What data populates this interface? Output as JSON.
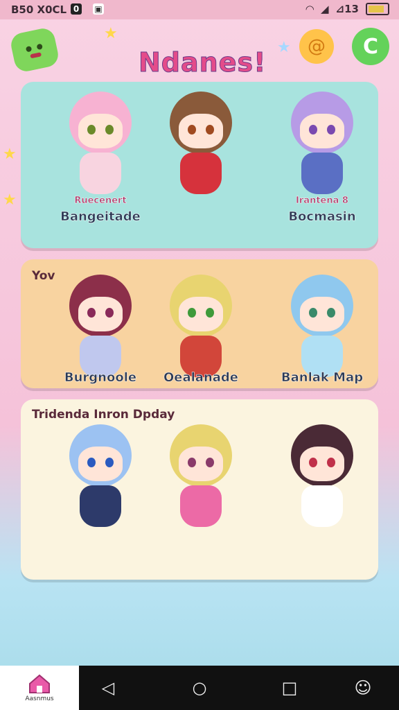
{
  "status_bar": {
    "left_text": "B50 X0CL",
    "badge": "0",
    "right_text": "⊿13"
  },
  "header": {
    "title": "Ndanes!"
  },
  "sections": [
    {
      "label": "",
      "characters": [
        {
          "name": "Bangeitade",
          "caption": "Ruecenert",
          "hair": "#f7b2d2",
          "outfit": "#f8d4e0",
          "eye": "#6a8a2a"
        },
        {
          "name": "",
          "caption": "",
          "hair": "#8a5a3a",
          "outfit": "#d6323c",
          "eye": "#a04a20"
        },
        {
          "name": "Bocmasin",
          "caption": "Irantena 8",
          "hair": "#b79be6",
          "outfit": "#5a6fc4",
          "eye": "#7a4ab0"
        }
      ]
    },
    {
      "label": "Yov",
      "characters": [
        {
          "name": "Burgnoole",
          "caption": "",
          "hair": "#8c2f4a",
          "outfit": "#c0c8ee",
          "eye": "#8a2a5a"
        },
        {
          "name": "Oealanade",
          "caption": "",
          "hair": "#e8d470",
          "outfit": "#d2463a",
          "eye": "#3f9a3a"
        },
        {
          "name": "Banlak Map",
          "caption": "",
          "hair": "#8fc8ee",
          "outfit": "#b0e0f4",
          "eye": "#3a8a6a"
        }
      ]
    },
    {
      "label": "Tridenda Inron Dpday",
      "characters": [
        {
          "name": "",
          "caption": "",
          "hair": "#9cc2f2",
          "outfit": "#2d3a6a",
          "eye": "#2a5ac0"
        },
        {
          "name": "",
          "caption": "",
          "hair": "#e8d470",
          "outfit": "#ec6aa6",
          "eye": "#8a3a6a"
        },
        {
          "name": "",
          "caption": "",
          "hair": "#4a2a36",
          "outfit": "#ffffff",
          "eye": "#c0304a"
        }
      ]
    }
  ],
  "nav": {
    "home_label": "Aasnmus"
  },
  "colors": {
    "card1": "#a8e3de",
    "card2": "#f8d3a0",
    "card3": "#fbf4df"
  }
}
